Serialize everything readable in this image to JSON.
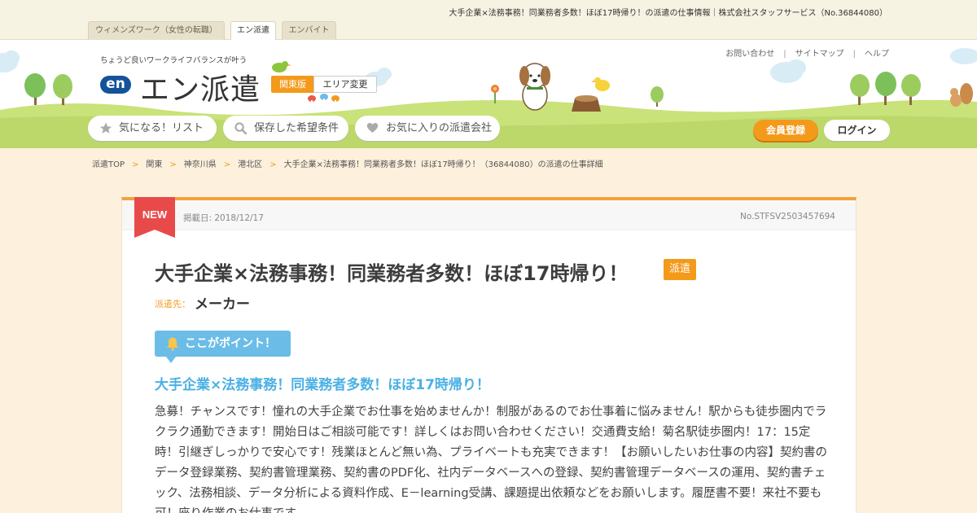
{
  "page_heading": "大手企業×法務事務！同業務者多数！ほぼ17時帰り！の派遣の仕事情報｜株式会社スタッフサービス（No.36844080）",
  "site_tabs": [
    {
      "label": "ウィメンズワーク（女性の転職）"
    },
    {
      "label": "エン派遣"
    },
    {
      "label": "エンバイト"
    }
  ],
  "header": {
    "tagline": "ちょうど良いワークライフバランスが叶う",
    "logo_mark": "en",
    "logo_text": "エン派遣",
    "region": "関東版",
    "area_change": "エリア変更",
    "util_links": [
      "お問い合わせ",
      "サイトマップ",
      "ヘルプ"
    ],
    "nav": [
      {
        "label": "気になる！リスト",
        "icon": "star-icon"
      },
      {
        "label": "保存した希望条件",
        "icon": "search-icon"
      },
      {
        "label": "お気に入りの派遣会社",
        "icon": "heart-icon"
      }
    ],
    "register": "会員登録",
    "login": "ログイン"
  },
  "breadcrumb": [
    "派遣TOP",
    "関東",
    "神奈川県",
    "港北区",
    "大手企業×法務事務！同業務者多数！ほぼ17時帰り！（36844080）の派遣の仕事詳細"
  ],
  "job": {
    "new_label": "NEW",
    "posted": "掲載日: 2018/12/17",
    "number": "No.STFSV2503457694",
    "title": "大手企業×法務事務！同業務者多数！ほぼ17時帰り！",
    "type_badge": "派遣",
    "destination_label": "派遣先：",
    "destination": "メーカー",
    "point_label": "ここがポイント！",
    "catch": "大手企業×法務事務！同業務者多数！ほぼ17時帰り！",
    "description": "急募！チャンスです！憧れの大手企業でお仕事を始めませんか！制服があるのでお仕事着に悩みません！駅からも徒歩圏内でラクラク通勤できます！開始日はご相談可能です！詳しくはお問い合わせください！交通費支給！菊名駅徒歩圏内！17：15定時！引継ぎしっかりで安心です！残業ほとんど無い為、プライベートも充実できます！【お願いしたいお仕事の内容】契約書のデータ登録業務、契約書管理業務、契約書のPDF化、社内データベースへの登録、契約書管理データベースの運用、契約書チェック、法務相談、データ分析による資料作成、E－learning受講、課題提出依頼などをお願いします。履歴書不要！来社不要も可！座り作業のお仕事です。"
  },
  "colors": {
    "accent": "#f39a1b",
    "point_blue": "#6bbde8",
    "catch_blue": "#4ab0e4",
    "grass": "#c9e27a",
    "page_bg": "#fdf0dc",
    "new_red": "#e84a4a"
  }
}
